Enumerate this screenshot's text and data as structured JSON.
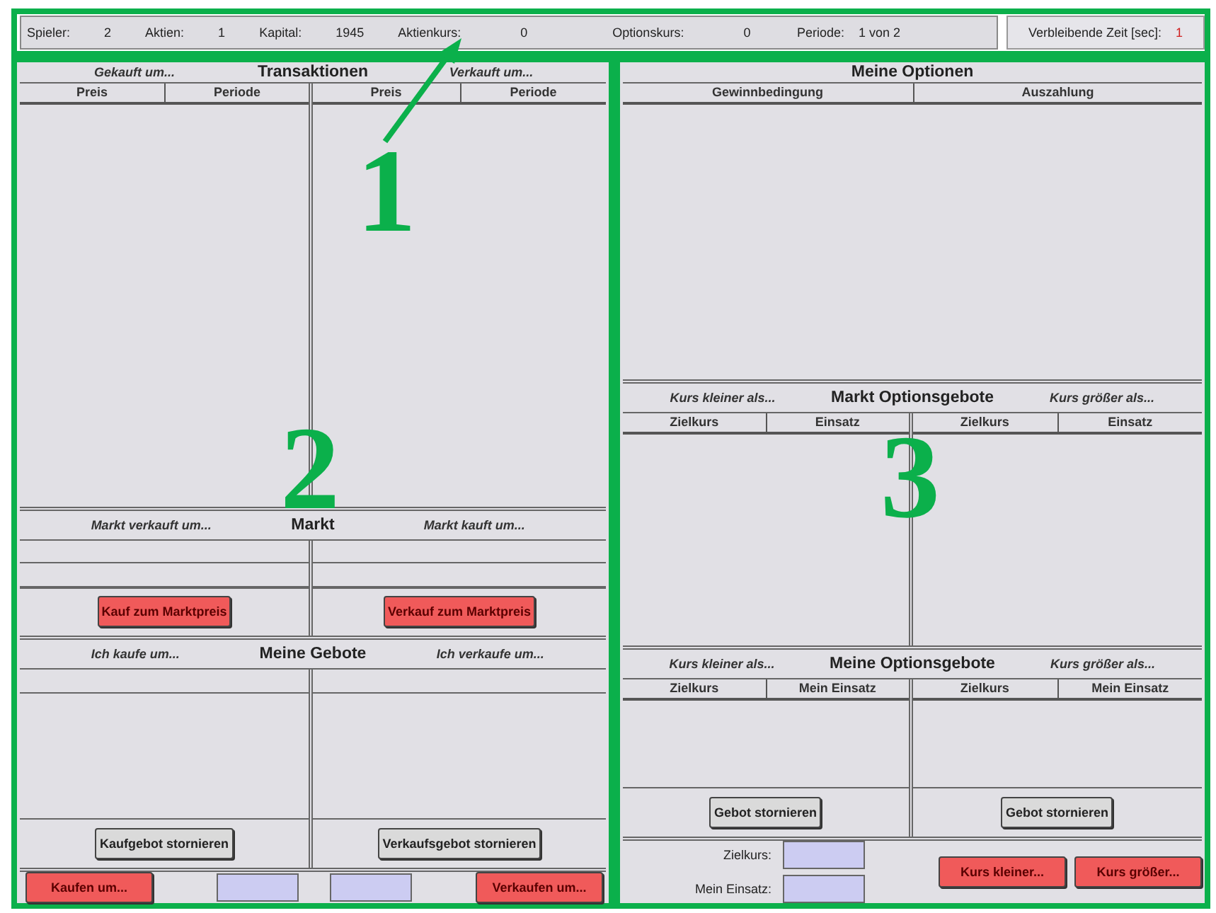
{
  "status_bar": {
    "fields": [
      {
        "label": "Spieler:",
        "value": "2"
      },
      {
        "label": "Aktien:",
        "value": "1"
      },
      {
        "label": "Kapital:",
        "value": "1945"
      },
      {
        "label": "Aktienkurs:",
        "value": "0"
      },
      {
        "label": "Optionskurs:",
        "value": "0"
      },
      {
        "label": "Periode:",
        "value": "1 von 2"
      }
    ],
    "timer": {
      "label": "Verbleibende Zeit [sec]:",
      "value": "1"
    }
  },
  "transaktionen": {
    "title": "Transaktionen",
    "left": {
      "caption": "Gekauft um...",
      "columns": [
        "Preis",
        "Periode"
      ]
    },
    "right": {
      "caption": "Verkauft um...",
      "columns": [
        "Preis",
        "Periode"
      ]
    }
  },
  "markt": {
    "title": "Markt",
    "left": {
      "caption": "Markt verkauft um...",
      "button": "Kauf zum Marktpreis"
    },
    "right": {
      "caption": "Markt kauft um...",
      "button": "Verkauf zum Marktpreis"
    }
  },
  "meine_gebote": {
    "title": "Meine Gebote",
    "left": {
      "caption": "Ich kaufe um...",
      "button": "Kaufgebot stornieren"
    },
    "right": {
      "caption": "Ich verkaufe um...",
      "button": "Verkaufsgebot stornieren"
    }
  },
  "order_bar": {
    "buy_button": "Kaufen um...",
    "sell_button": "Verkaufen um..."
  },
  "meine_optionen": {
    "title": "Meine Optionen",
    "columns": [
      "Gewinnbedingung",
      "Auszahlung"
    ]
  },
  "markt_optionsgebote": {
    "title": "Markt Optionsgebote",
    "left": {
      "caption": "Kurs kleiner als...",
      "columns": [
        "Zielkurs",
        "Einsatz"
      ]
    },
    "right": {
      "caption": "Kurs größer als...",
      "columns": [
        "Zielkurs",
        "Einsatz"
      ]
    }
  },
  "meine_optionsgebote": {
    "title": "Meine Optionsgebote",
    "left": {
      "caption": "Kurs kleiner als...",
      "columns": [
        "Zielkurs",
        "Mein Einsatz"
      ],
      "button": "Gebot stornieren"
    },
    "right": {
      "caption": "Kurs größer als...",
      "columns": [
        "Zielkurs",
        "Mein Einsatz"
      ],
      "button": "Gebot stornieren"
    }
  },
  "option_form": {
    "fields": [
      {
        "label": "Zielkurs:"
      },
      {
        "label": "Mein Einsatz:"
      }
    ],
    "buttons": [
      "Kurs kleiner...",
      "Kurs größer..."
    ]
  },
  "annotations": [
    "1",
    "2",
    "3"
  ]
}
